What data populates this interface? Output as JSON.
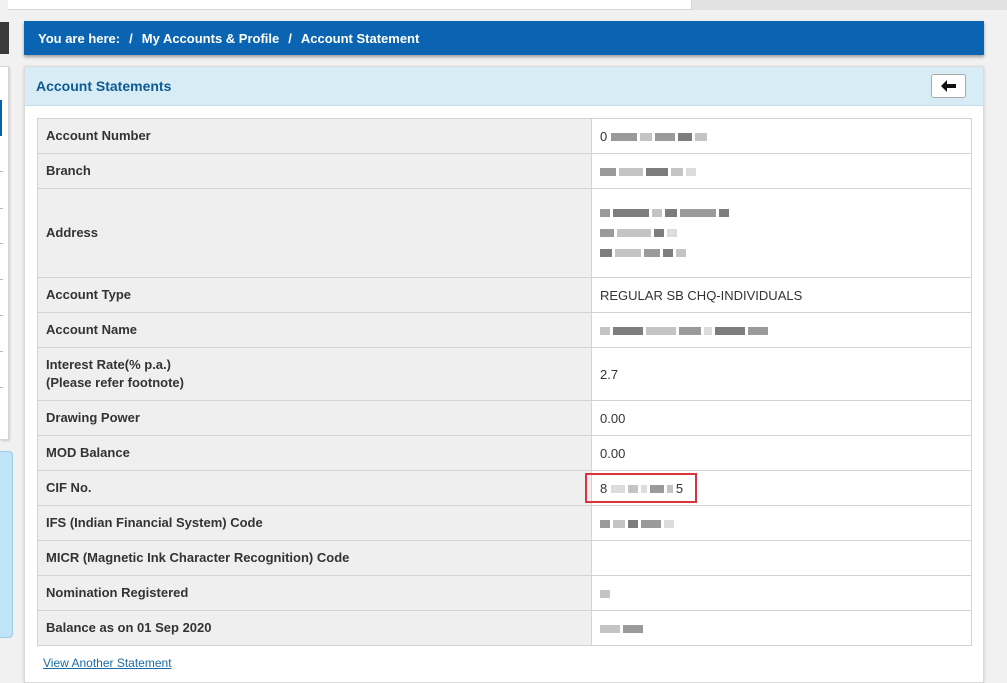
{
  "breadcrumb": {
    "prefix": "You are here:",
    "separator": "/",
    "items": [
      "My Accounts & Profile",
      "Account Statement"
    ]
  },
  "panel": {
    "title": "Account Statements",
    "back_icon": "arrow-left-icon"
  },
  "details": {
    "account_number": {
      "label": "Account Number",
      "visible_value": "0"
    },
    "branch": {
      "label": "Branch"
    },
    "address": {
      "label": "Address"
    },
    "account_type": {
      "label": "Account Type",
      "value": "REGULAR SB CHQ-INDIVIDUALS"
    },
    "account_name": {
      "label": "Account Name"
    },
    "interest_rate": {
      "label_line1": "Interest Rate(% p.a.)",
      "label_line2": "(Please refer footnote)",
      "value": "2.7"
    },
    "drawing_power": {
      "label": "Drawing Power",
      "value": "0.00"
    },
    "mod_balance": {
      "label": "MOD Balance",
      "value": "0.00"
    },
    "cif_no": {
      "label": "CIF No.",
      "visible_prefix": "8",
      "visible_suffix": "5"
    },
    "ifs_code": {
      "label": "IFS (Indian Financial System) Code"
    },
    "micr_code": {
      "label": "MICR (Magnetic Ink Character Recognition) Code",
      "value": ""
    },
    "nomination": {
      "label": "Nomination Registered"
    },
    "balance": {
      "label": "Balance as on 01 Sep 2020"
    }
  },
  "links": {
    "view_another": "View Another Statement"
  },
  "colors": {
    "breadcrumb_bg": "#0b64b1",
    "header_bg": "#d8ecf5",
    "title_color": "#0d5a94",
    "highlight_border": "#d9343a"
  }
}
